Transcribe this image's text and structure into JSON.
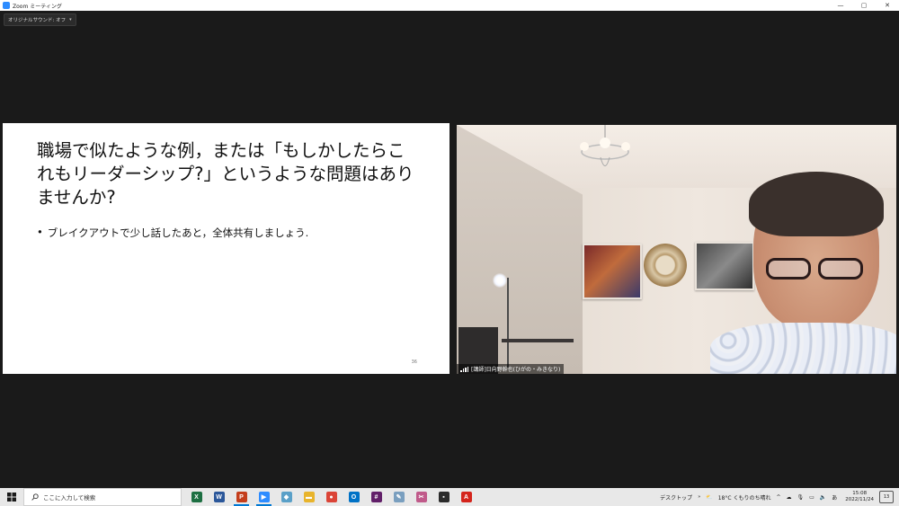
{
  "window": {
    "title": "Zoom ミーティング",
    "controls": {
      "minimize": "—",
      "maximize": "▢",
      "close": "✕"
    }
  },
  "audio": {
    "label": "オリジナルサウンド: オフ",
    "caret": "▾"
  },
  "slide": {
    "title": "職場で似たような例，または「もしかしたらこれもリーダーシップ?」というような問題はありませんか?",
    "bullet_mark": "•",
    "bullet": "ブレイクアウトで少し話したあと，全体共有しましょう.",
    "page_number": "36"
  },
  "video": {
    "participant_name": "[講師]日向野幹也(ひがの・みきなり)"
  },
  "taskbar": {
    "search_placeholder": "ここに入力して検索",
    "apps": [
      {
        "icon": "excel-icon",
        "glyph": "X",
        "color": "#1d6f42",
        "active": false
      },
      {
        "icon": "word-icon",
        "glyph": "W",
        "color": "#2b579a",
        "active": false
      },
      {
        "icon": "powerpoint-icon",
        "glyph": "P",
        "color": "#c43e1c",
        "active": true
      },
      {
        "icon": "zoom-icon",
        "glyph": "▶",
        "color": "#2d8cff",
        "active": true
      },
      {
        "icon": "app-generic-icon",
        "glyph": "◆",
        "color": "#5aa0c8",
        "active": false
      },
      {
        "icon": "file-explorer-icon",
        "glyph": "▬",
        "color": "#e8b42c",
        "active": false
      },
      {
        "icon": "chrome-icon",
        "glyph": "●",
        "color": "#db4437",
        "active": false
      },
      {
        "icon": "outlook-icon",
        "glyph": "O",
        "color": "#0072c6",
        "active": false
      },
      {
        "icon": "slack-icon",
        "glyph": "#",
        "color": "#611f69",
        "active": false
      },
      {
        "icon": "paint-icon",
        "glyph": "✎",
        "color": "#7a9fbf",
        "active": false
      },
      {
        "icon": "snipping-tool-icon",
        "glyph": "✂",
        "color": "#c05a8a",
        "active": false
      },
      {
        "icon": "sticky-notes-icon",
        "glyph": "▪",
        "color": "#2b2b2b",
        "active": false
      },
      {
        "icon": "acrobat-icon",
        "glyph": "A",
        "color": "#d4241c",
        "active": false
      }
    ],
    "desktop_label": "デスクトップ",
    "weather": "18°C  くもりのち晴れ",
    "ime": "あ",
    "time": "15:08",
    "date": "2022/11/24",
    "notifications": "13"
  },
  "colors": {
    "accent": "#0078d4",
    "zoom_blue": "#2d8cff",
    "meeting_bg": "#1a1a1a"
  }
}
